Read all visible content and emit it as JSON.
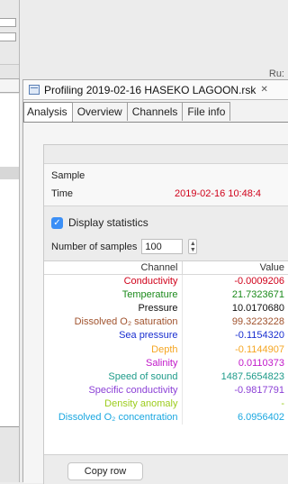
{
  "header": {
    "run_label": "Ru:"
  },
  "editor": {
    "title": "Profiling 2019-02-16 HASEKO LAGOON.rsk",
    "close_glyph": "✕",
    "tabs": [
      "Analysis",
      "Overview",
      "Channels",
      "File info"
    ]
  },
  "analysis": {
    "sample_label": "Sample",
    "time_label": "Time",
    "time_value": "2019-02-16 10:48:4",
    "display_statistics": "Display statistics",
    "number_of_samples_label": "Number of samples",
    "number_of_samples_value": "100",
    "columns": [
      "Channel",
      "Value"
    ],
    "rows": [
      {
        "channel": "Conductivity",
        "value": "-0.0009206",
        "color": "#d0021b"
      },
      {
        "channel": "Temperature",
        "value": "21.7323671",
        "color": "#1b8a1b"
      },
      {
        "channel": "Pressure",
        "value": "10.0170680",
        "color": "#111111"
      },
      {
        "channel": "Dissolved O₂ saturation",
        "value": "99.3223228",
        "color": "#a0522d"
      },
      {
        "channel": "Sea pressure",
        "value": "-0.1154320",
        "color": "#1a2fd0"
      },
      {
        "channel": "Depth",
        "value": "-0.1144907",
        "color": "#f5a623"
      },
      {
        "channel": "Salinity",
        "value": "0.0110373",
        "color": "#c118c9"
      },
      {
        "channel": "Speed of sound",
        "value": "1487.5654823",
        "color": "#1e9b8a"
      },
      {
        "channel": "Specific conductivity",
        "value": "-0.9817791",
        "color": "#8b3fd6"
      },
      {
        "channel": "Density anomaly",
        "value": "-",
        "color": "#9ccc1c"
      },
      {
        "channel": "Dissolved O₂ concentration",
        "value": "6.0956402",
        "color": "#1aa7e0"
      }
    ],
    "copy_row": "Copy row"
  }
}
